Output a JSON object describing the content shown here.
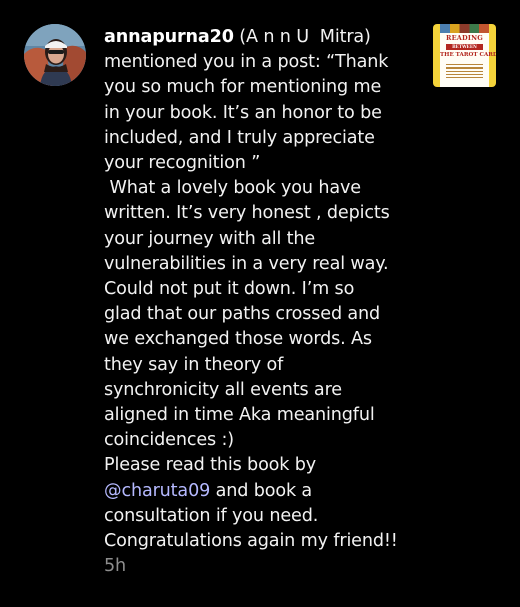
{
  "notification": {
    "username": "annapurna20",
    "display_name": " (A n n U  Mitra)",
    "action_prefix": "mentioned you in a post: ",
    "message_lines": [
      "mentioned you in a post: “Thank",
      "you so much for mentioning me",
      "in your book. It’s an honor to be",
      "included, and I truly appreciate",
      "your recognition ”",
      " What a lovely book you have",
      "written. It’s very honest , depicts",
      "your journey with all the",
      "vulnerabilities in a very real way.",
      "Could not put it down. I’m so",
      "glad that our paths crossed and",
      "we exchanged those words. As",
      "they say in theory of",
      "synchronicity all events are",
      "aligned in time Aka meaningful",
      "coincidences :)",
      "Please read this book by"
    ],
    "mention_handle": "@charuta09",
    "mention_suffix": " and book a",
    "closing_lines": [
      "consultation if you need.",
      "Congratulations again my friend!!"
    ],
    "timestamp": "5h"
  },
  "post_thumbnail": {
    "title_top": "READING",
    "title_mid": "BETWEEN",
    "title_bottom": "THE TAROT CARDS"
  },
  "colors": {
    "background": "#000000",
    "text": "#f2f2f2",
    "mention": "#b5b9ff",
    "timestamp": "#8e8e8e",
    "thumbnail_background": "#f4d33a"
  },
  "icons": {
    "avatar": "profile-photo",
    "mention_prefix": "threads-at-icon"
  }
}
